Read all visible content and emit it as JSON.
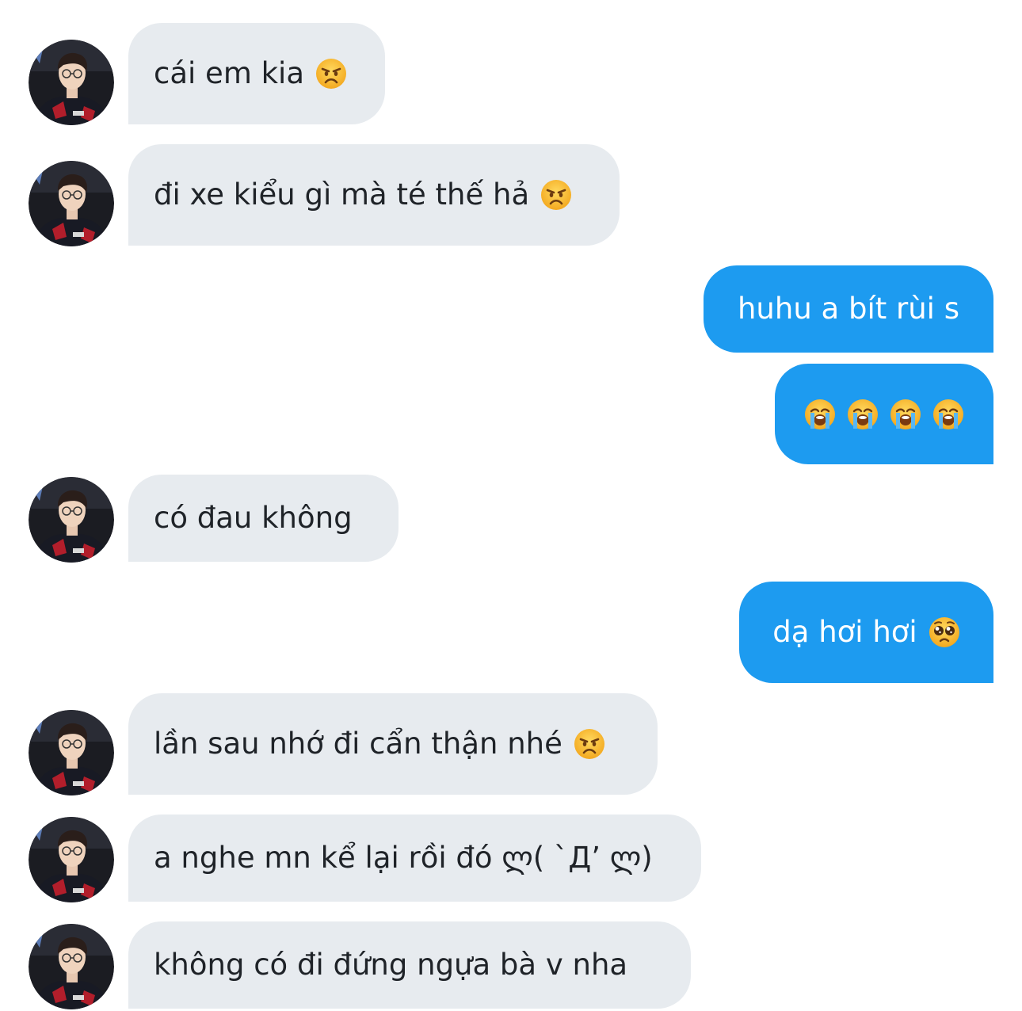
{
  "messages": [
    {
      "id": "m1",
      "side": "received",
      "text": "cái em kia",
      "emoji": [
        "angry-face-icon"
      ]
    },
    {
      "id": "m2",
      "side": "received",
      "text": "đi xe kiểu gì mà té thế hả",
      "emoji": [
        "angry-face-icon"
      ]
    },
    {
      "id": "m3",
      "side": "sent",
      "text": "huhu a bít rùi s",
      "emoji": []
    },
    {
      "id": "m4",
      "side": "sent",
      "text": "",
      "emoji": [
        "loudly-crying-face-icon",
        "loudly-crying-face-icon",
        "loudly-crying-face-icon",
        "loudly-crying-face-icon"
      ]
    },
    {
      "id": "m5",
      "side": "received",
      "text": "có đau không",
      "emoji": []
    },
    {
      "id": "m6",
      "side": "sent",
      "text": "dạ hơi hơi",
      "emoji": [
        "pleading-face-icon"
      ]
    },
    {
      "id": "m7",
      "side": "received",
      "text": "lần sau nhớ đi cẩn thận nhé",
      "emoji": [
        "angry-face-icon"
      ]
    },
    {
      "id": "m8",
      "side": "received",
      "text": "a nghe mn kể lại rồi đó ლ( `Д’ ლ)",
      "emoji": []
    },
    {
      "id": "m9",
      "side": "received",
      "text": "không có đi đứng ngựa bà v nha",
      "emoji": []
    }
  ],
  "colors": {
    "received_bubble": "#e7ebef",
    "sent_bubble": "#1d9bf0",
    "sent_text": "#ffffff",
    "received_text": "#1f2328"
  }
}
